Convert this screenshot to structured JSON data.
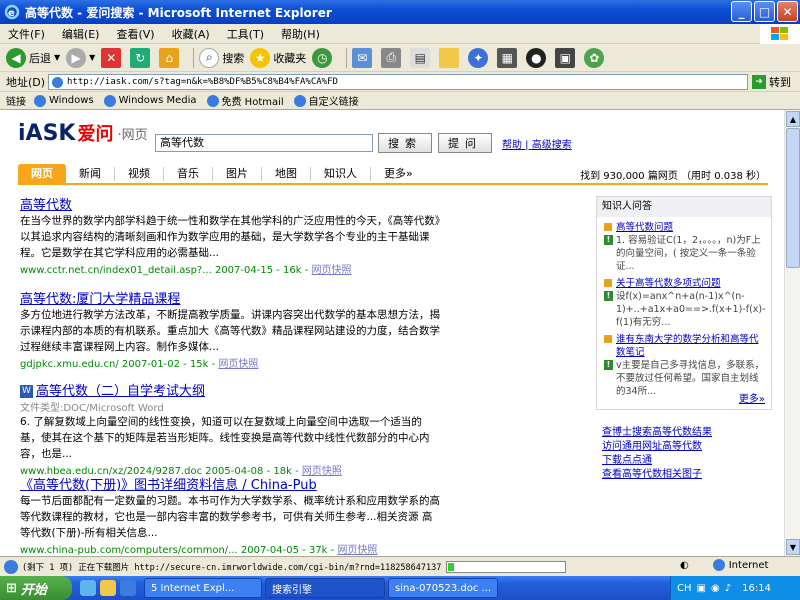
{
  "window": {
    "title": "高等代数 - 爱问搜索 - Microsoft Internet Explorer",
    "buttons": {
      "minimize": "_",
      "maximize": "□",
      "close": "✕"
    }
  },
  "menu": [
    "文件(F)",
    "编辑(E)",
    "查看(V)",
    "收藏(A)",
    "工具(T)",
    "帮助(H)"
  ],
  "toolbar": {
    "back": "后退",
    "search": "搜索",
    "favorites": "收藏夹"
  },
  "address": {
    "label": "地址(D)",
    "url": "http://iask.com/s?tag=n&k=%B8%DF%B5%C8%B4%FA%CA%FD",
    "go": "转到"
  },
  "links": {
    "label": "链接",
    "items": [
      "Windows",
      "Windows Media",
      "免费 Hotmail",
      "自定义链接"
    ]
  },
  "site": {
    "logo": "iASK",
    "logo_ai": "爱问",
    "logo_sub": "·网页",
    "query": "高等代数",
    "search_button": "搜索",
    "ask_button": "提问",
    "help": "帮助",
    "advanced": "高级搜索",
    "tabs": [
      "网页",
      "新闻",
      "视频",
      "音乐",
      "图片",
      "地图",
      "知识人",
      "更多»"
    ],
    "result_info": "找到 930,000 篇网页 （用时 0.038 秒）"
  },
  "results": [
    {
      "title": "高等代数",
      "snippet": "在当今世界的数学内部学科趋于统一性和数学在其他学科的广泛应用性的今天，《高等代数》以其追求内容结构的清晰刻画和作为数学应用的基础，是大学数学各个专业的主干基础课程。它是数学在其它学科应用的必需基础...",
      "url": "www.cctr.net.cn/index01_detail.asp?... 2007-04-15 - 16k - ",
      "cache": "网页快照"
    },
    {
      "title": "高等代数:厦门大学精品课程",
      "snippet": "多方位地进行教学方法改革，不断提高教学质量。讲课内容突出代数学的基本思想方法，揭示课程内部的本质的有机联系。重点加大《高等代数》精品课程网站建设的力度，结合数学过程继续丰富课程网上内容。制作多媒体...",
      "url": "gdjpkc.xmu.edu.cn/ 2007-01-02 - 15k - ",
      "cache": "网页快照"
    },
    {
      "title": "高等代数（二）自学考试大纲",
      "filetype": "文件类型:DOC/Microsoft Word",
      "snippet": "6. 了解复数域上向量空间的线性变换，知道可以在复数域上向量空间中选取一个适当的基，使其在这个基下的矩阵是若当形矩阵。线性变换是高等代数中线性代数部分的中心内容，也是...",
      "url": "www.hbea.edu.cn/xz/2024/9287.doc 2005-04-08 - 18k - ",
      "cache": "网页快照"
    },
    {
      "title": "《高等代数(下册)》图书详细资料信息 / China-Pub",
      "snippet": "每一节后面都配有一定数量的习题。本书可作为大学数学系、概率统计系和应用数学系的高等代数课程的教材，它也是一部内容丰富的数学参考书，可供有关师生参考...相关资源 高等代数(下册)-所有相关信息...",
      "url": "www.china-pub.com/computers/common/... 2007-04-05 - 37k - ",
      "cache": "网页快照"
    }
  ],
  "sidebar": {
    "header": "知识人问答",
    "qa": [
      {
        "q": "高等代数问题",
        "a": "1. 容易验证C(1，2，。。。，n)为F上的向量空间，( 按定义一条一条验证..."
      },
      {
        "q": "关于高等代数多项式问题",
        "a": "设f(x)=anx^n+a(n-1)x^(n-1)+..+a1x+a0==>.f(x+1)-f(x)-f(1)有无穷..."
      },
      {
        "q": "谁有东南大学的数学分析和高等代数笔记",
        "a": "v主要是自己多寻找信息，多联系，不要放过任何希望。国家自主划线的34所..."
      }
    ],
    "more": "更多»",
    "links": [
      "查博士搜索高等代数结果",
      "访问通用网址高等代数",
      "下载点点通",
      "查看高等代数相关图子"
    ]
  },
  "status": {
    "text": "(剩下 1 项) 正在下载图片 http://secure-cn.imrworldwide.com/cgi-bin/m?rnd=1182586471375&ci=cn-sina2006&",
    "progress": 0.05,
    "zone": "Internet"
  },
  "taskbar": {
    "start": "开始",
    "tasks": [
      "5 Internet Expl...",
      "搜索引擎",
      "sina-070523.doc ..."
    ],
    "clock": "16:14",
    "lang": "CH"
  },
  "colors": {
    "accent_orange": "#f9a51a",
    "link_blue": "#0000cc",
    "url_green": "#008000",
    "highlight_red": "#cc0000"
  }
}
